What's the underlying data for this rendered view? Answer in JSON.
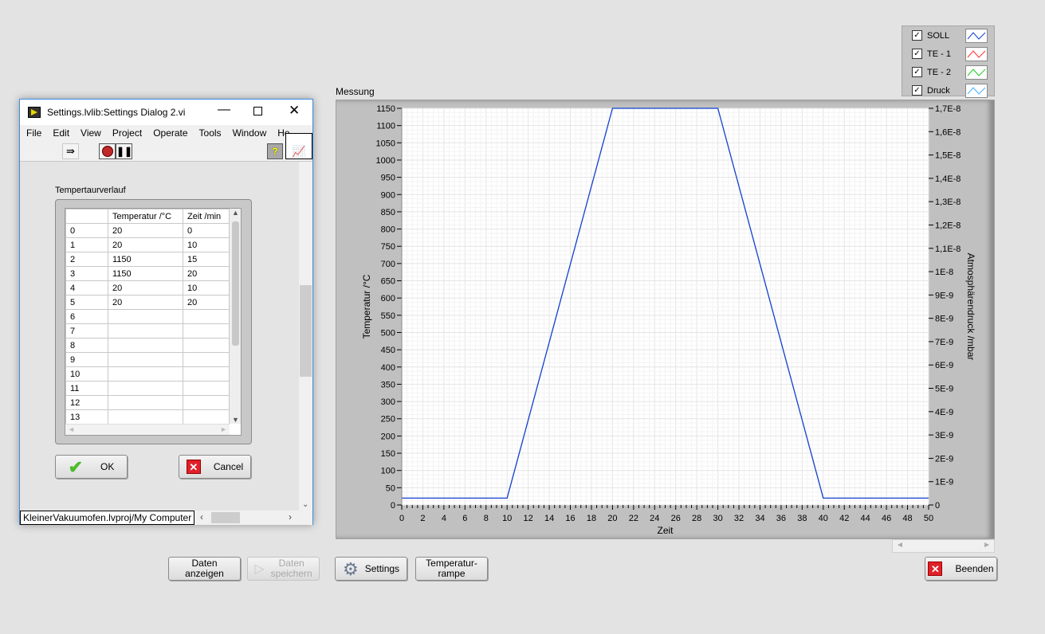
{
  "legend": {
    "items": [
      {
        "label": "SOLL",
        "color": "#1040d0",
        "checked": true
      },
      {
        "label": "TE - 1",
        "color": "#ff3030",
        "checked": true
      },
      {
        "label": "TE - 2",
        "color": "#20d020",
        "checked": true
      },
      {
        "label": "Druck",
        "color": "#40b0ff",
        "checked": true
      }
    ]
  },
  "graph": {
    "label": "Messung"
  },
  "chart_data": {
    "type": "line",
    "xlabel": "Zeit",
    "ylabel": "Temperatur /°C",
    "y2label": "Atmosphärendruck /mbar",
    "xlim": [
      0,
      50
    ],
    "ylim": [
      0,
      1150
    ],
    "y2lim": [
      0,
      1.7e-08
    ],
    "xticks": [
      0,
      2,
      4,
      6,
      8,
      10,
      12,
      14,
      16,
      18,
      20,
      22,
      24,
      26,
      28,
      30,
      32,
      34,
      36,
      38,
      40,
      42,
      44,
      46,
      48,
      50
    ],
    "yticks": [
      0,
      50,
      100,
      150,
      200,
      250,
      300,
      350,
      400,
      450,
      500,
      550,
      600,
      650,
      700,
      750,
      800,
      850,
      900,
      950,
      1000,
      1050,
      1100,
      1150
    ],
    "y2ticks": [
      "0",
      "1E-9",
      "2E-9",
      "3E-9",
      "4E-9",
      "5E-9",
      "6E-9",
      "7E-9",
      "8E-9",
      "9E-9",
      "1E-8",
      "1,1E-8",
      "1,2E-8",
      "1,3E-8",
      "1,4E-8",
      "1,5E-8",
      "1,6E-8",
      "1,7E-8"
    ],
    "grid": true,
    "series": [
      {
        "name": "SOLL",
        "color": "#1040d0",
        "x": [
          0,
          10,
          20,
          30,
          40,
          50
        ],
        "y": [
          20,
          20,
          1150,
          1150,
          20,
          20
        ]
      }
    ]
  },
  "buttons": {
    "daten_anzeigen": "Daten\nanzeigen",
    "daten_speichern": "Daten\nspeichern",
    "settings": "Settings",
    "temperaturrampe": "Temperatur-\nrampe",
    "beenden": "Beenden"
  },
  "dialog": {
    "title": "Settings.lvlib:Settings Dialog 2.vi",
    "menu": [
      "File",
      "Edit",
      "View",
      "Project",
      "Operate",
      "Tools",
      "Window",
      "He"
    ],
    "table_label": "Tempertaurverlauf",
    "columns": [
      "",
      "Temperatur /°C",
      "Zeit /min"
    ],
    "rows": [
      [
        "0",
        "20",
        "0"
      ],
      [
        "1",
        "20",
        "10"
      ],
      [
        "2",
        "1150",
        "15"
      ],
      [
        "3",
        "1150",
        "20"
      ],
      [
        "4",
        "20",
        "10"
      ],
      [
        "5",
        "20",
        "20"
      ],
      [
        "6",
        "",
        ""
      ],
      [
        "7",
        "",
        ""
      ],
      [
        "8",
        "",
        ""
      ],
      [
        "9",
        "",
        ""
      ],
      [
        "10",
        "",
        ""
      ],
      [
        "11",
        "",
        ""
      ],
      [
        "12",
        "",
        ""
      ],
      [
        "13",
        "",
        ""
      ]
    ],
    "ok": "OK",
    "cancel": "Cancel",
    "status": "KleinerVakuumofen.lvproj/My Computer"
  }
}
